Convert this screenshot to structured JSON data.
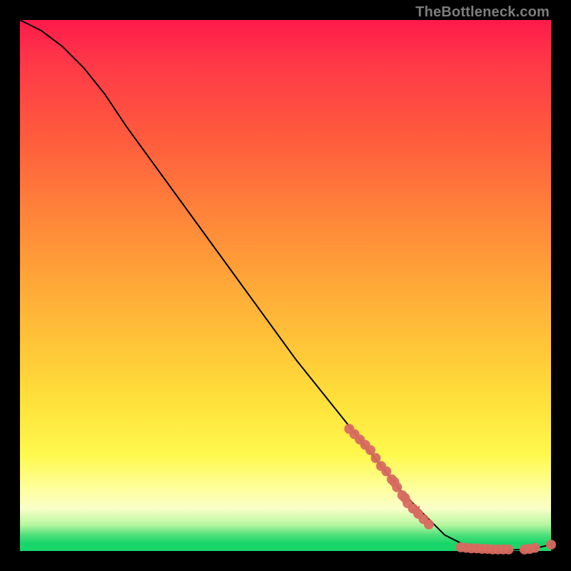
{
  "watermark": "TheBottleneck.com",
  "chart_data": {
    "type": "line",
    "title": "",
    "xlabel": "",
    "ylabel": "",
    "xlim": [
      0,
      100
    ],
    "ylim": [
      0,
      100
    ],
    "grid": false,
    "legend": false,
    "series": [
      {
        "name": "curve",
        "kind": "line",
        "color": "#000000",
        "x": [
          0,
          4,
          8,
          12,
          16,
          20,
          28,
          36,
          44,
          52,
          60,
          68,
          72,
          76,
          80,
          84,
          88,
          92,
          96,
          100
        ],
        "y": [
          100,
          98,
          95,
          91,
          86,
          80,
          69,
          58,
          47,
          36,
          26,
          16,
          11,
          7,
          3,
          1,
          0.4,
          0.2,
          0.3,
          1.2
        ]
      },
      {
        "name": "dots-upper",
        "kind": "scatter",
        "color": "#d86a60",
        "x": [
          62,
          63,
          64,
          65,
          66,
          67,
          68,
          69,
          70,
          70.5,
          71,
          72,
          72.5,
          73,
          74,
          75,
          76,
          77
        ],
        "y": [
          23,
          22,
          21,
          20,
          19,
          17.5,
          16,
          15,
          13.5,
          13,
          12,
          10.5,
          10,
          9,
          8,
          7,
          6,
          5
        ]
      },
      {
        "name": "arrow-marker",
        "kind": "scatter",
        "color": "#d86a60",
        "x": [
          74.5
        ],
        "y": [
          7.2
        ]
      },
      {
        "name": "dots-bottom",
        "kind": "scatter",
        "color": "#d86a60",
        "x": [
          83,
          84,
          85,
          86,
          87,
          88,
          89,
          90,
          91,
          92,
          95,
          96,
          97,
          100
        ],
        "y": [
          0.7,
          0.6,
          0.5,
          0.5,
          0.4,
          0.4,
          0.3,
          0.3,
          0.3,
          0.3,
          0.3,
          0.4,
          0.6,
          1.2
        ]
      }
    ]
  }
}
